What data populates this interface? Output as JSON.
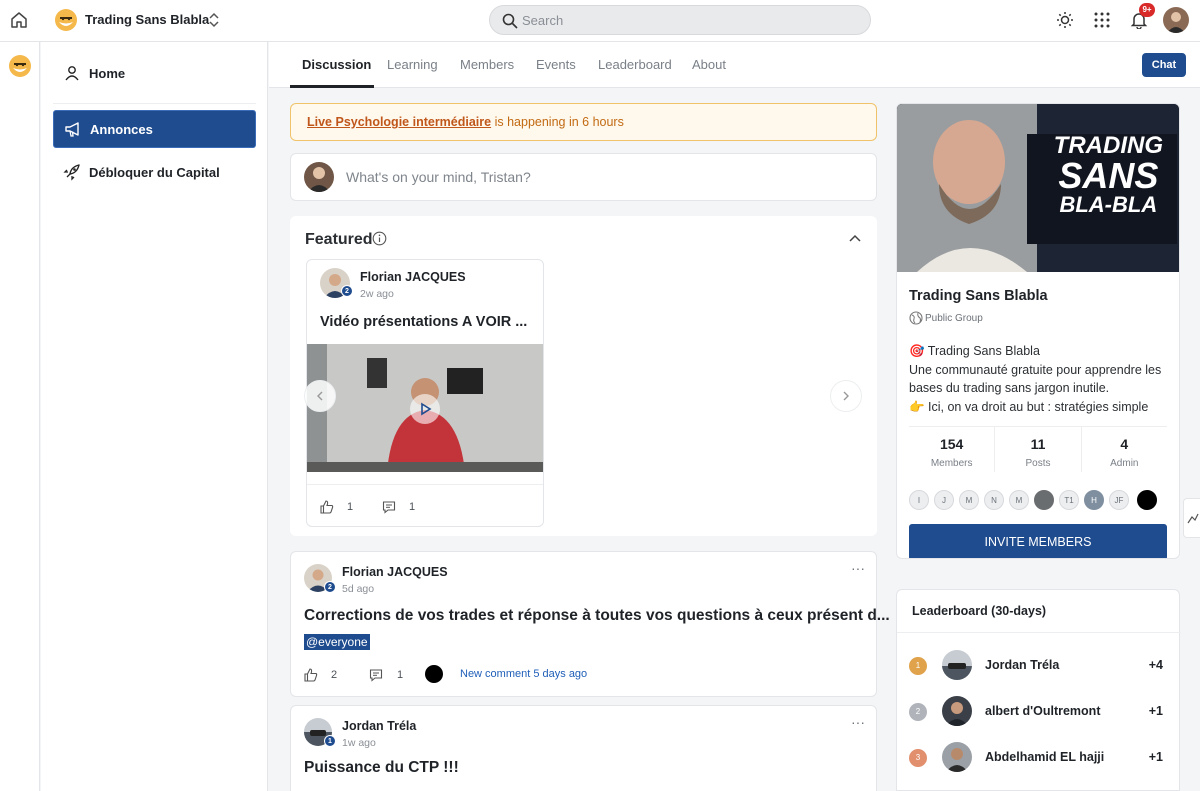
{
  "header": {
    "brand_title": "Trading Sans Blabla",
    "search_placeholder": "Search",
    "notif_badge": "9+"
  },
  "sidebar": {
    "items": [
      {
        "label": "Home",
        "icon": "user-icon"
      },
      {
        "label": "Annonces",
        "icon": "megaphone-icon"
      },
      {
        "label": "Débloquer du Capital",
        "icon": "rocket-icon"
      }
    ]
  },
  "tabs": [
    "Discussion",
    "Learning",
    "Members",
    "Events",
    "Leaderboard",
    "About"
  ],
  "chat_label": "Chat",
  "alert": {
    "link_text": "Live Psychologie intermédiaire",
    "rest_text": " is happening in 6 hours"
  },
  "composer": {
    "placeholder": "What's on your mind, Tristan?"
  },
  "featured": {
    "title": "Featured",
    "card": {
      "author": "Florian JACQUES",
      "level": "2",
      "time": "2w ago",
      "title": "Vidéo présentations A VOIR ...",
      "likes": "1",
      "comments": "1"
    }
  },
  "posts": [
    {
      "author": "Florian JACQUES",
      "level": "2",
      "time": "5d ago",
      "title": "Corrections de vos trades et réponse à toutes vos questions à ceux présent d...",
      "mention": "@everyone",
      "likes": "2",
      "comments": "1",
      "new_comment": "New comment 5 days ago"
    },
    {
      "author": "Jordan Tréla",
      "level": "1",
      "time": "1w ago",
      "title": "Puissance du CTP !!!"
    }
  ],
  "group": {
    "banner_lines": [
      "TRADING",
      "SANS",
      "BLA-BLA"
    ],
    "name": "Trading Sans Blabla",
    "type": "Public Group",
    "desc_line1": "🎯 Trading Sans Blabla",
    "desc_line2": "Une communauté gratuite pour apprendre les bases du trading sans jargon inutile.",
    "desc_line3": "👉 Ici, on va droit au but : stratégies simple",
    "stats": [
      {
        "value": "154",
        "label": "Members"
      },
      {
        "value": "11",
        "label": "Posts"
      },
      {
        "value": "4",
        "label": "Admin"
      }
    ],
    "member_initials": [
      "I",
      "J",
      "M",
      "N",
      "M",
      "",
      "T1",
      "H",
      "JF",
      ""
    ],
    "invite_label": "INVITE MEMBERS"
  },
  "leaderboard": {
    "title": "Leaderboard (30-days)",
    "rows": [
      {
        "rank": "1",
        "name": "Jordan Tréla",
        "points": "+4",
        "color": "#e0a24a"
      },
      {
        "rank": "2",
        "name": "albert d'Oultremont",
        "points": "+1",
        "color": "#b0b4ba"
      },
      {
        "rank": "3",
        "name": "Abdelhamid EL hajji",
        "points": "+1",
        "color": "#e28f6d"
      }
    ]
  },
  "colors": {
    "accent": "#1f4c8f",
    "alert_text": "#c26a12",
    "link": "#1f5fb8"
  }
}
